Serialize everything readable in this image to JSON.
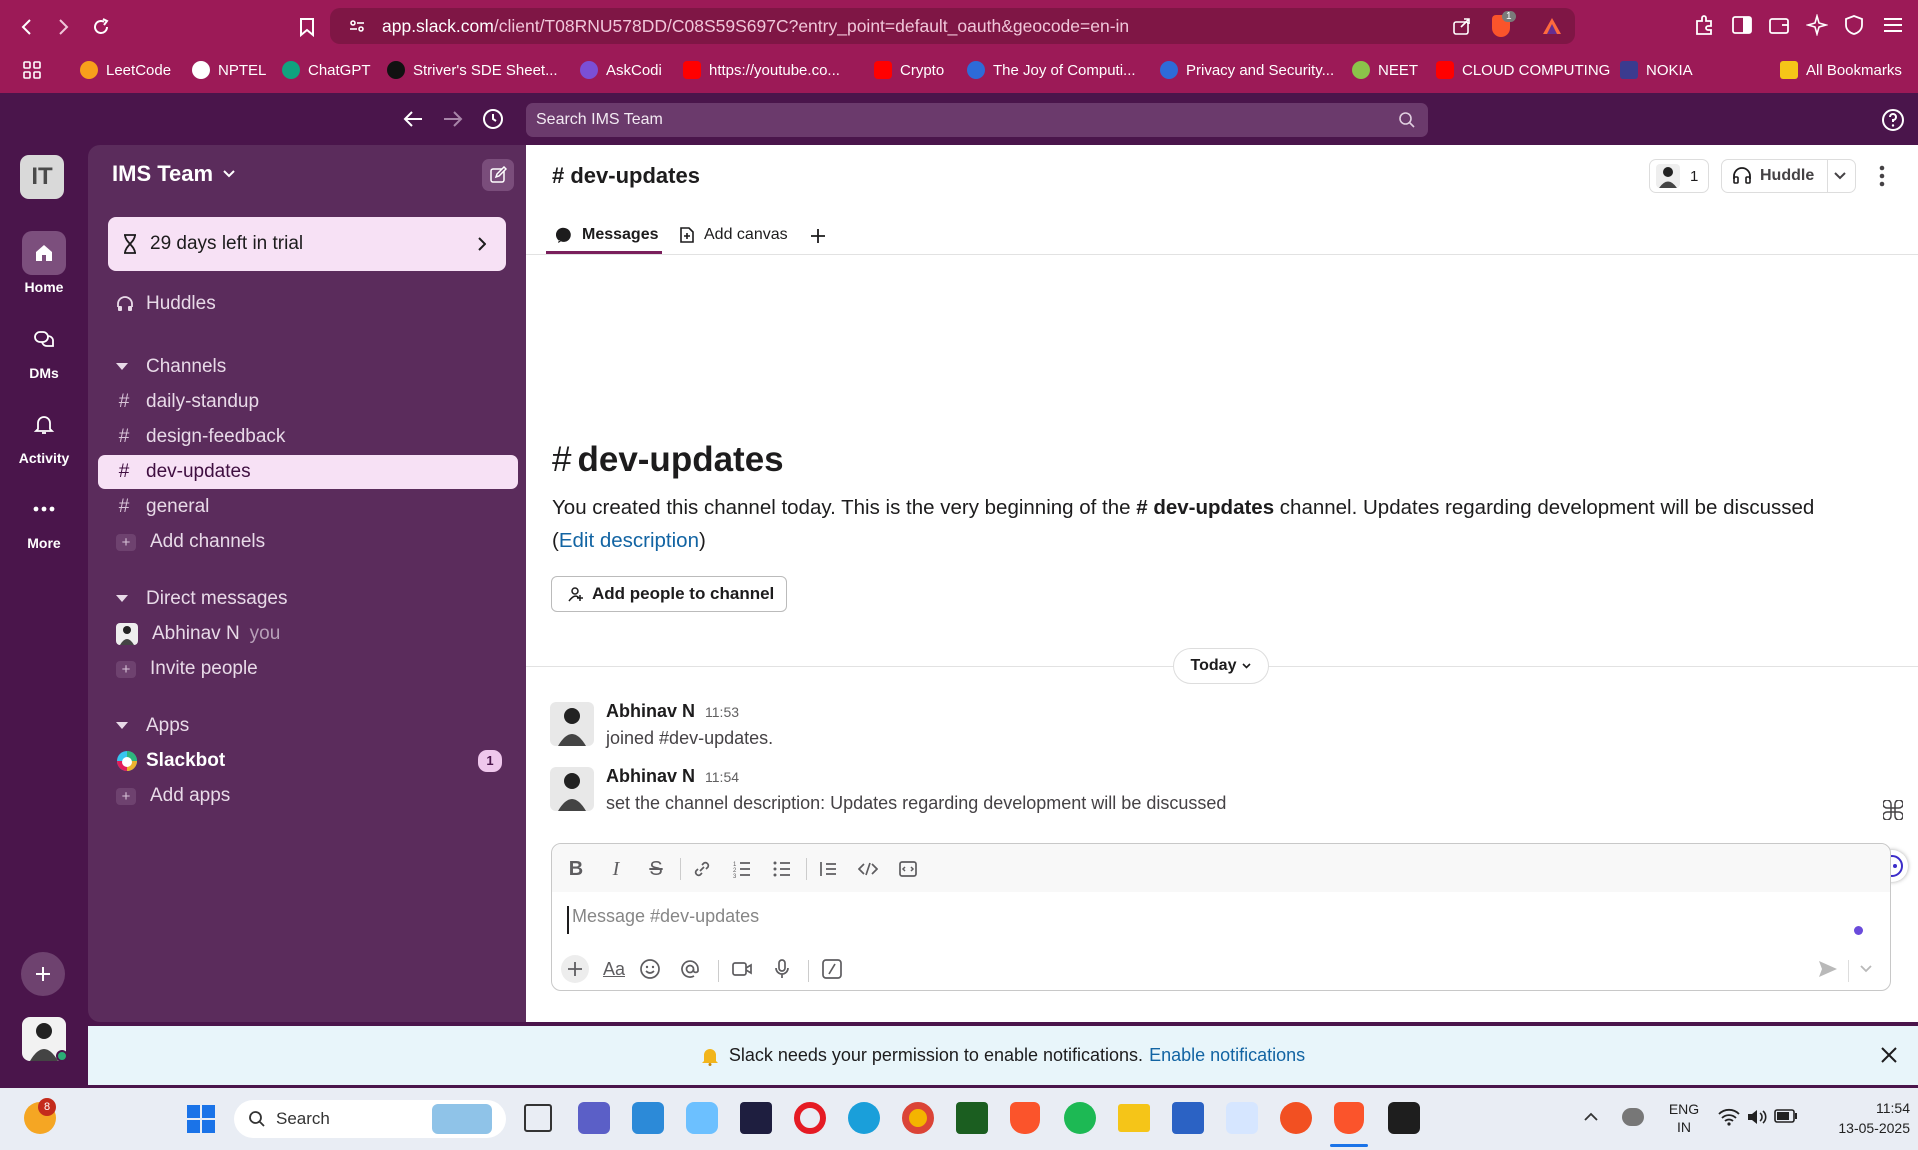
{
  "browser": {
    "url_host": "app.slack.com",
    "url_path": "/client/T08RNU578DD/C08S59S697C?entry_point=default_oauth&geocode=en-in",
    "bookmarks": [
      {
        "label": "LeetCode",
        "color": "#f89f1b"
      },
      {
        "label": "NPTEL",
        "color": "#ffffff"
      },
      {
        "label": "ChatGPT",
        "color": "#10a37f"
      },
      {
        "label": "Striver's SDE Sheet...",
        "color": "#111111"
      },
      {
        "label": "AskCodi",
        "color": "#7b4fd6"
      },
      {
        "label": "https://youtube.co...",
        "color": "#ff0000"
      },
      {
        "label": "Crypto",
        "color": "#ff0000"
      },
      {
        "label": "The Joy of Computi...",
        "color": "#2e6bd8"
      },
      {
        "label": "Privacy and Security...",
        "color": "#2e6bd8"
      },
      {
        "label": "NEET",
        "color": "#8bc34a"
      },
      {
        "label": "CLOUD COMPUTING",
        "color": "#ff0000"
      },
      {
        "label": "NOKIA",
        "color": "#3b3b8f"
      }
    ],
    "all_bookmarks": "All Bookmarks",
    "brave_badge": "1"
  },
  "slack": {
    "search_placeholder": "Search IMS Team",
    "rail": {
      "workspace_initials": "IT",
      "home": "Home",
      "dms": "DMs",
      "activity": "Activity",
      "more": "More"
    },
    "sidebar": {
      "workspace_name": "IMS Team",
      "trial_text": "29 days left in trial",
      "huddles": "Huddles",
      "channels_header": "Channels",
      "channels": [
        "daily-standup",
        "design-feedback",
        "dev-updates",
        "general"
      ],
      "add_channels": "Add channels",
      "dm_header": "Direct messages",
      "dm_user": "Abhinav N",
      "dm_you": "you",
      "invite_people": "Invite people",
      "apps_header": "Apps",
      "slackbot": "Slackbot",
      "slackbot_badge": "1",
      "add_apps": "Add apps"
    },
    "channel": {
      "name": "# dev-updates",
      "member_count": "1",
      "huddle_label": "Huddle",
      "tabs": {
        "messages": "Messages",
        "add_canvas": "Add canvas"
      },
      "intro_title": "dev-updates",
      "intro_text_1": "You created this channel today. This is the very beginning of the ",
      "intro_channel": "# dev-updates",
      "intro_text_2": " channel. Updates regarding development will be discussed",
      "edit_description": "Edit description",
      "add_people": "Add people to channel",
      "date_divider": "Today"
    },
    "messages": [
      {
        "author": "Abhinav N",
        "time": "11:53",
        "text": "joined #dev-updates."
      },
      {
        "author": "Abhinav N",
        "time": "11:54",
        "text": "set the channel description: Updates regarding development will be discussed"
      }
    ],
    "composer": {
      "placeholder": "Message #dev-updates",
      "format_label": "Aa"
    },
    "notification": {
      "text": "Slack needs your permission to enable notifications.",
      "link": "Enable notifications"
    }
  },
  "taskbar": {
    "search": "Search",
    "language": "ENG",
    "region": "IN",
    "time": "11:54",
    "date": "13-05-2025",
    "weather_badge": "8"
  }
}
